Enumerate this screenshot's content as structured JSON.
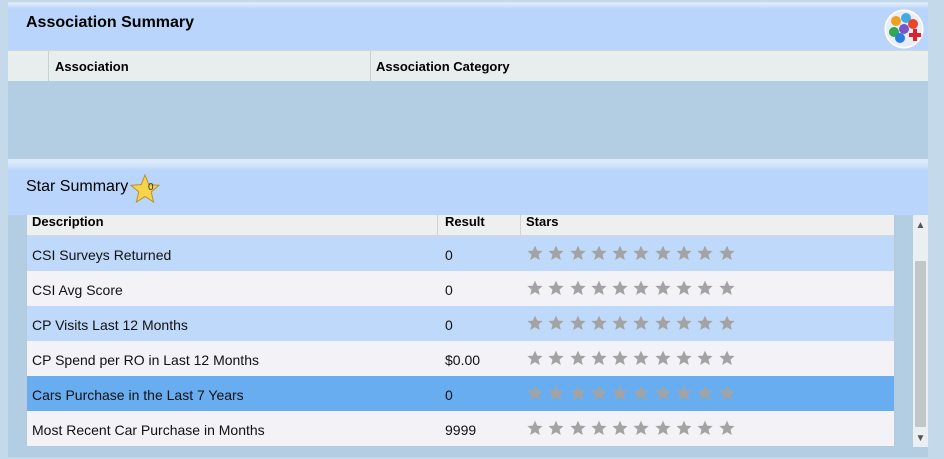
{
  "association_summary": {
    "title": "Association Summary",
    "icon": "add-users-icon",
    "columns": [
      "Association",
      "Association Category"
    ]
  },
  "star_summary": {
    "title": "Star Summary",
    "badge_icon": "star-badge-icon",
    "badge_count": "0",
    "columns": [
      "Description",
      "Result",
      "Stars"
    ],
    "max_stars": 10,
    "rows": [
      {
        "description": "CSI Surveys Returned",
        "result": "0",
        "stars": 0,
        "style": "blue"
      },
      {
        "description": "CSI Avg Score",
        "result": "0",
        "stars": 0,
        "style": "light"
      },
      {
        "description": "CP Visits Last 12 Months",
        "result": "0",
        "stars": 0,
        "style": "blue"
      },
      {
        "description": "CP Spend per RO in Last 12 Months",
        "result": "$0.00",
        "stars": 0,
        "style": "light"
      },
      {
        "description": "Cars Purchase in the Last 7 Years",
        "result": "0",
        "stars": 0,
        "style": "selected"
      },
      {
        "description": "Most Recent Car Purchase in Months",
        "result": "9999",
        "stars": 0,
        "style": "light"
      }
    ]
  },
  "colors": {
    "header_blue": "#b9d5fb",
    "row_blue": "#bed9fa",
    "row_selected": "#69adf1",
    "star_empty": "#a3a3a3",
    "star_filled": "#f5c518"
  },
  "scrollbar": {
    "up_icon": "chevron-up-icon",
    "down_icon": "chevron-down-icon"
  }
}
